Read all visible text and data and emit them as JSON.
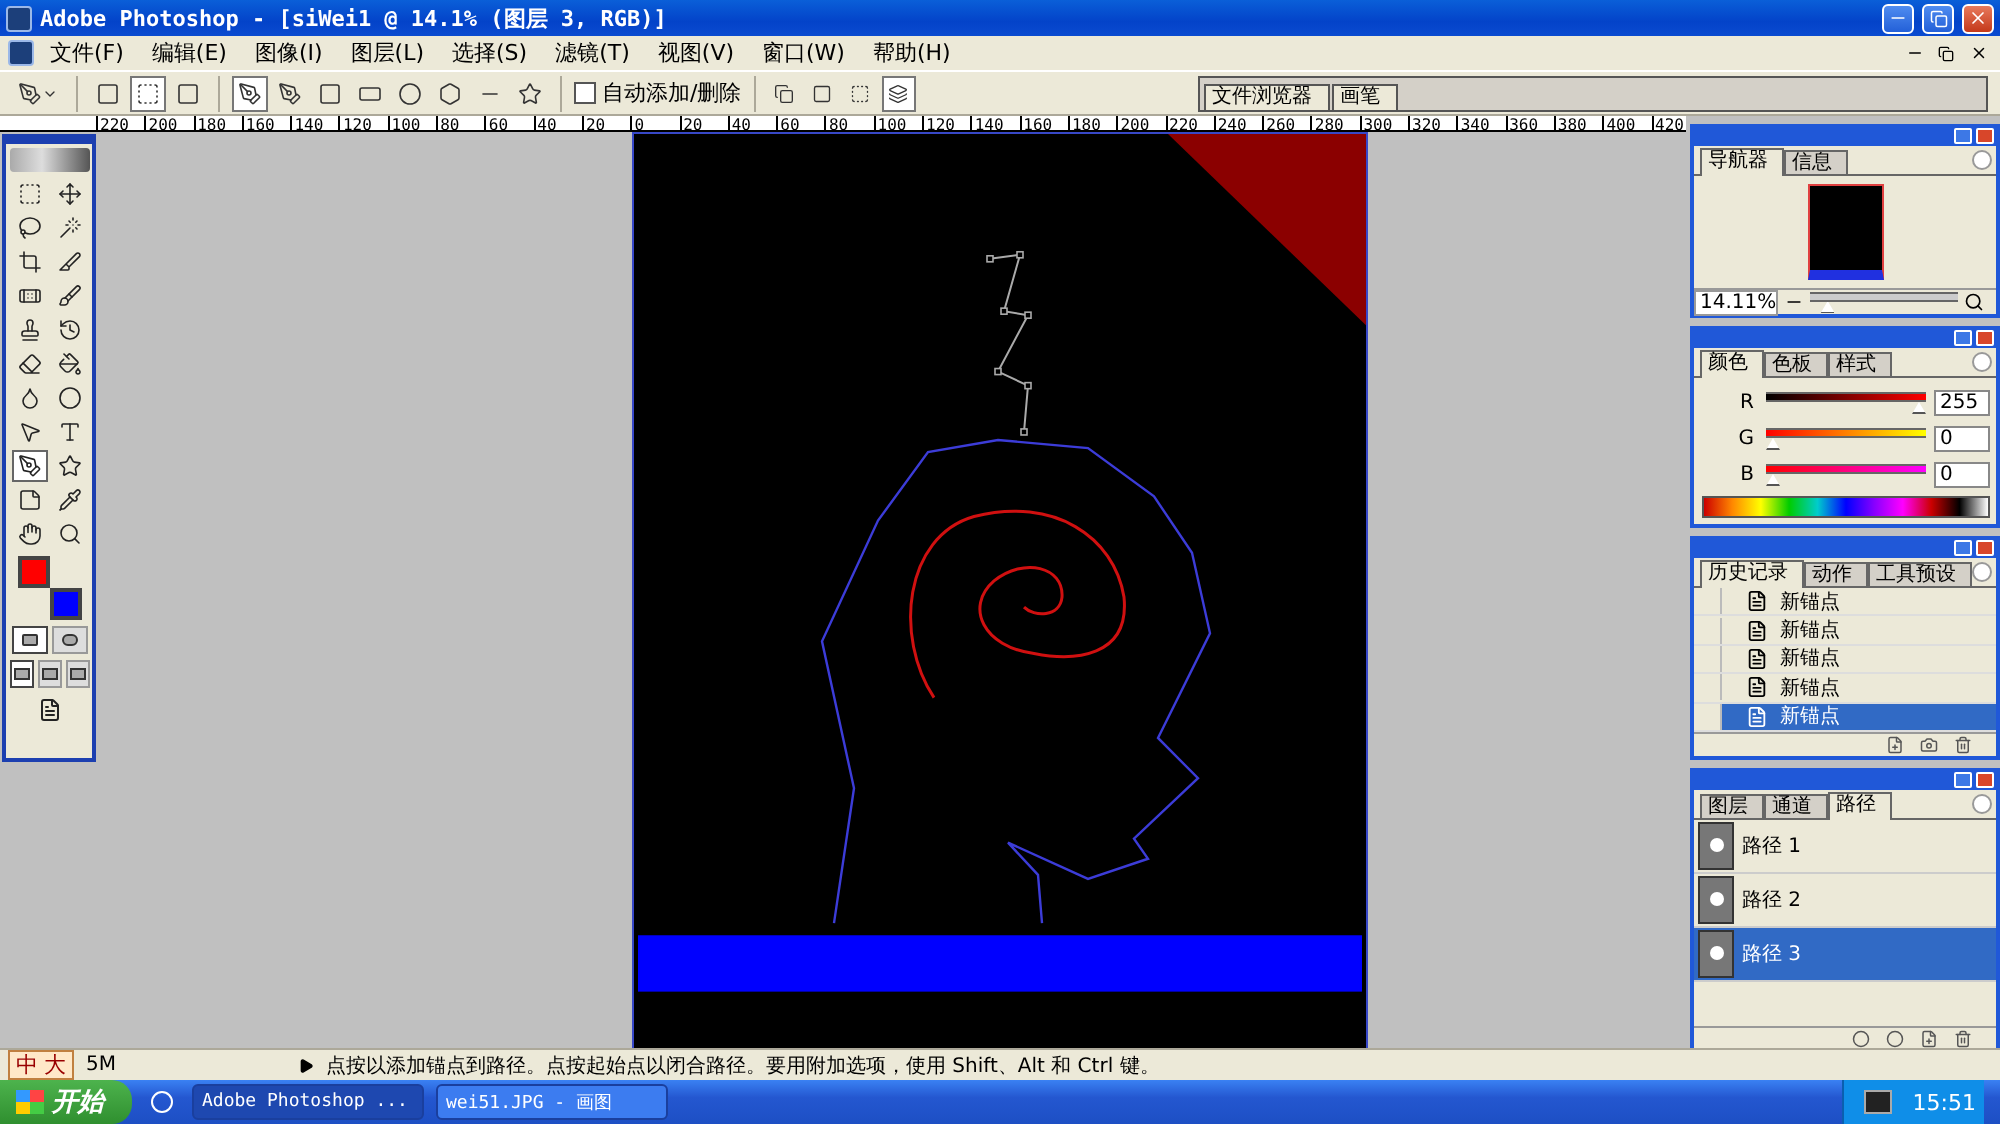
{
  "window": {
    "title": "Adobe Photoshop - [siWei1 @ 14.1% (图层 3, RGB)]"
  },
  "menu": [
    "文件(F)",
    "编辑(E)",
    "图像(I)",
    "图层(L)",
    "选择(S)",
    "滤镜(T)",
    "视图(V)",
    "窗口(W)",
    "帮助(H)"
  ],
  "options_bar": {
    "preset": {
      "kind": "pen",
      "selected": false
    },
    "modes": [
      {
        "kind": "shape-layers",
        "selected": false
      },
      {
        "kind": "paths",
        "selected": true
      },
      {
        "kind": "fill-pixels",
        "selected": false
      }
    ],
    "tools": [
      {
        "kind": "pen",
        "selected": true
      },
      {
        "kind": "freeform-pen",
        "selected": false
      },
      {
        "kind": "rect",
        "selected": false
      },
      {
        "kind": "rounded-rect",
        "selected": false
      },
      {
        "kind": "ellipse",
        "selected": false
      },
      {
        "kind": "polygon",
        "selected": false
      },
      {
        "kind": "line",
        "selected": false
      },
      {
        "kind": "custom-shape",
        "selected": false
      }
    ],
    "checkbox": {
      "label": "自动添加/删除",
      "checked": false
    },
    "ops": [
      {
        "kind": "add",
        "selected": false
      },
      {
        "kind": "subtract",
        "selected": false
      },
      {
        "kind": "intersect",
        "selected": false
      },
      {
        "kind": "exclude",
        "selected": true
      }
    ],
    "palette_well": [
      "文件浏览器",
      "画笔"
    ]
  },
  "ruler": [
    "220",
    "200",
    "180",
    "160",
    "140",
    "120",
    "100",
    "80",
    "60",
    "40",
    "20",
    "0",
    "20",
    "40",
    "60",
    "80",
    "100",
    "120",
    "140",
    "160",
    "180",
    "200",
    "220",
    "240",
    "260",
    "280",
    "300",
    "320",
    "340",
    "360",
    "380",
    "400",
    "420"
  ],
  "toolbox": {
    "tools": [
      {
        "kind": "marquee",
        "selected": false
      },
      {
        "kind": "move",
        "selected": false
      },
      {
        "kind": "lasso",
        "selected": false
      },
      {
        "kind": "wand",
        "selected": false
      },
      {
        "kind": "crop",
        "selected": false
      },
      {
        "kind": "slice",
        "selected": false
      },
      {
        "kind": "healing",
        "selected": false
      },
      {
        "kind": "brush",
        "selected": false
      },
      {
        "kind": "stamp",
        "selected": false
      },
      {
        "kind": "history-brush",
        "selected": false
      },
      {
        "kind": "eraser",
        "selected": false
      },
      {
        "kind": "bucket",
        "selected": false
      },
      {
        "kind": "blur",
        "selected": false
      },
      {
        "kind": "dodge",
        "selected": false
      },
      {
        "kind": "path-select",
        "selected": false
      },
      {
        "kind": "type",
        "selected": false
      },
      {
        "kind": "pen",
        "selected": true
      },
      {
        "kind": "custom-shape",
        "selected": false
      },
      {
        "kind": "notes",
        "selected": false
      },
      {
        "kind": "eyedropper",
        "selected": false
      },
      {
        "kind": "hand",
        "selected": false
      },
      {
        "kind": "zoom",
        "selected": false
      }
    ],
    "colors": [
      {
        "color": "#ff0000"
      },
      {
        "color": "#0000ff"
      }
    ],
    "mask_modes": [
      {
        "selected": true
      },
      {
        "selected": false
      }
    ],
    "screen_modes": [
      {
        "selected": true
      },
      {
        "selected": false
      },
      {
        "selected": false
      }
    ]
  },
  "navigator": {
    "tabs": [
      {
        "label": "导航器",
        "selected": true
      },
      {
        "label": "信息",
        "selected": false
      }
    ],
    "zoom": "14.11%",
    "level": 0.08
  },
  "color": {
    "tabs": [
      {
        "label": "颜色",
        "selected": true
      },
      {
        "label": "色板",
        "selected": false
      },
      {
        "label": "样式",
        "selected": false
      }
    ],
    "channels": [
      {
        "name": "R",
        "level": 1,
        "value": "255"
      },
      {
        "name": "G",
        "level": 0,
        "value": "0"
      },
      {
        "name": "B",
        "level": 0,
        "value": "0"
      }
    ]
  },
  "history": {
    "tabs": [
      {
        "label": "历史记录",
        "selected": true
      },
      {
        "label": "动作",
        "selected": false
      },
      {
        "label": "工具预设",
        "selected": false
      }
    ],
    "items": [
      {
        "label": "新锚点",
        "selected": false
      },
      {
        "label": "新锚点",
        "selected": false
      },
      {
        "label": "新锚点",
        "selected": false
      },
      {
        "label": "新锚点",
        "selected": false
      },
      {
        "label": "新锚点",
        "selected": true
      }
    ]
  },
  "paths": {
    "tabs": [
      {
        "label": "图层",
        "selected": false
      },
      {
        "label": "通道",
        "selected": false
      },
      {
        "label": "路径",
        "selected": true
      }
    ],
    "items": [
      {
        "label": "路径 1",
        "selected": false
      },
      {
        "label": "路径 2",
        "selected": false
      },
      {
        "label": "路径 3",
        "selected": true
      }
    ]
  },
  "status_bar": {
    "ime": [
      "中",
      "大"
    ],
    "size": "5M",
    "hint": "点按以添加锚点到路径。点按起始点以闭合路径。要用附加选项，使用 Shift、Alt 和 Ctrl 键。"
  },
  "taskbar": {
    "start": "开始",
    "tasks": [
      {
        "label": "Adobe Photoshop ...",
        "selected": true
      },
      {
        "label": "wei51.JPG - 画图",
        "selected": false
      }
    ],
    "clock": "15:51"
  }
}
